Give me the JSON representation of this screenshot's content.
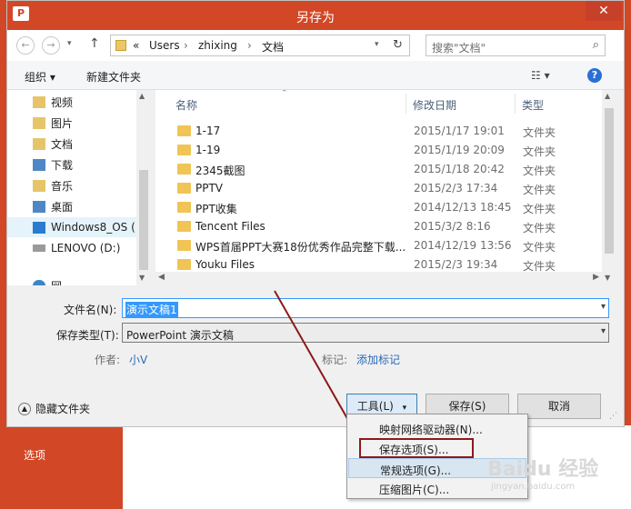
{
  "window": {
    "title": "另存为",
    "app_icon_text": "P"
  },
  "nav_buttons": {
    "back": "←",
    "forward": "→",
    "up": "↑",
    "refresh": "↻"
  },
  "address": {
    "prefix": "«",
    "segments": [
      "Users",
      "zhixing",
      "文档"
    ],
    "separator": "›"
  },
  "search": {
    "placeholder": "搜索\"文档\""
  },
  "toolbar": {
    "organize": "组织 ▾",
    "new_folder": "新建文件夹"
  },
  "nav_pane": {
    "items": [
      {
        "label": "视频",
        "icon": "video-library-icon"
      },
      {
        "label": "图片",
        "icon": "picture-library-icon"
      },
      {
        "label": "文档",
        "icon": "document-library-icon"
      },
      {
        "label": "下载",
        "icon": "download-folder-icon"
      },
      {
        "label": "音乐",
        "icon": "music-library-icon"
      },
      {
        "label": "桌面",
        "icon": "desktop-folder-icon"
      },
      {
        "label": "Windows8_OS (",
        "icon": "windows-drive-icon"
      },
      {
        "label": "LENOVO (D:)",
        "icon": "drive-icon"
      },
      {
        "label": "网",
        "icon": "network-icon"
      }
    ]
  },
  "file_list": {
    "columns": [
      "名称",
      "修改日期",
      "类型"
    ],
    "rows": [
      {
        "name": "1-17",
        "date": "2015/1/17 19:01",
        "type": "文件夹"
      },
      {
        "name": "1-19",
        "date": "2015/1/19 20:09",
        "type": "文件夹"
      },
      {
        "name": "2345截图",
        "date": "2015/1/18 20:42",
        "type": "文件夹"
      },
      {
        "name": "PPTV",
        "date": "2015/2/3 17:34",
        "type": "文件夹"
      },
      {
        "name": "PPT收集",
        "date": "2014/12/13 18:45",
        "type": "文件夹"
      },
      {
        "name": "Tencent Files",
        "date": "2015/3/2 8:16",
        "type": "文件夹"
      },
      {
        "name": "WPS首届PPT大赛18份优秀作品完整下载...",
        "date": "2014/12/19 13:56",
        "type": "文件夹"
      },
      {
        "name": "Youku Files",
        "date": "2015/2/3 19:34",
        "type": "文件夹"
      }
    ]
  },
  "form": {
    "filename_label": "文件名(N):",
    "filename_value": "演示文稿1",
    "filetype_label": "保存类型(T):",
    "filetype_value": "PowerPoint 演示文稿",
    "author_label": "作者:",
    "author_value": "小V",
    "tags_label": "标记:",
    "tags_value": "添加标记"
  },
  "buttons": {
    "hide_folders": "隐藏文件夹",
    "tools": "工具(L)",
    "save": "保存(S)",
    "cancel": "取消"
  },
  "tools_menu": {
    "items": [
      "映射网络驱动器(N)...",
      "保存选项(S)...",
      "常规选项(G)...",
      "压缩图片(C)..."
    ],
    "highlighted_index": 2
  },
  "background": {
    "options_label": "选项"
  },
  "watermark": {
    "text": "Baidu 经验",
    "sub": "jingyan.baidu.com"
  },
  "colors": {
    "accent": "#d24726",
    "selection": "#3399ff",
    "annotation": "#8b1a1a"
  }
}
